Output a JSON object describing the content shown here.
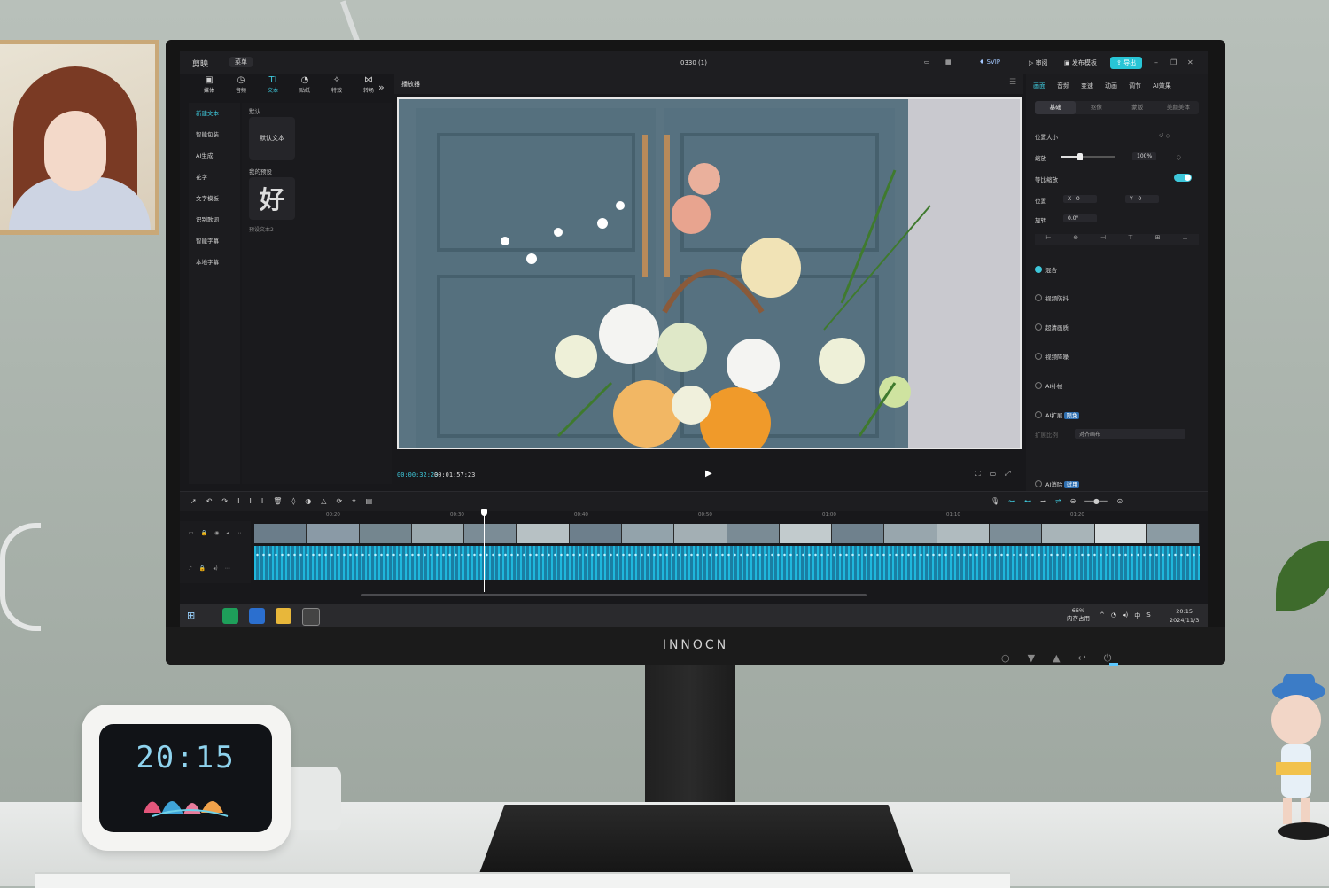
{
  "app": {
    "name": "剪映",
    "menu": "菜单",
    "doc_title": "0330 (1)",
    "svip": "SVIP",
    "buttons": {
      "feedback": "审阅",
      "publish": "发布模板",
      "export": "导出"
    }
  },
  "toolbar": {
    "tools": [
      {
        "label": "媒体",
        "icon": "media-icon"
      },
      {
        "label": "音频",
        "icon": "audio-icon"
      },
      {
        "label": "文本",
        "icon": "text-icon",
        "active": true
      },
      {
        "label": "贴纸",
        "icon": "sticker-icon"
      },
      {
        "label": "特效",
        "icon": "effects-icon"
      },
      {
        "label": "转场",
        "icon": "transition-icon"
      }
    ]
  },
  "text_panel": {
    "nav": [
      "新建文本",
      "智能包装",
      "AI生成",
      "花字",
      "文字模板",
      "识别歌词",
      "智能字幕",
      "本地字幕"
    ],
    "section_default": "默认",
    "default_card": "默认文本",
    "section_my": "我的预设",
    "preset_char": "好",
    "preset_caption": "预设文本2"
  },
  "player": {
    "title": "播放器",
    "time_current": "00:00:32:23",
    "time_total": "00:01:57:23"
  },
  "inspector": {
    "tabs": [
      "画面",
      "音频",
      "变速",
      "动画",
      "调节",
      "AI效果"
    ],
    "subtabs": [
      "基础",
      "抠像",
      "蒙版",
      "美颜美体"
    ],
    "position_size": "位置大小",
    "scale_label": "缩放",
    "scale_value": "100%",
    "uniform_scale": "等比缩放",
    "position_label": "位置",
    "pos_x_label": "X",
    "pos_x": "0",
    "pos_y_label": "Y",
    "pos_y": "0",
    "rotate_label": "旋转",
    "rotate_value": "0.0°",
    "blend": "混合",
    "stabilize": "视频防抖",
    "hd": "超清画质",
    "denoise": "视频降噪",
    "ai_fill": "AI补帧",
    "ai_expand": "AI扩展",
    "ai_expand_badge": "限免",
    "expand_ratio_label": "扩展比例",
    "expand_ratio_value": "对齐画布",
    "ai_remove": "AI消除",
    "ai_remove_badge": "试用"
  },
  "timeline": {
    "ticks": [
      "00:20",
      "00:30",
      "00:40",
      "00:50",
      "01:00",
      "01:10",
      "01:20"
    ]
  },
  "taskbar": {
    "memory_pct": "66%",
    "memory_label": "内存占用",
    "ime": "中",
    "time": "20:15",
    "date": "2024/11/3"
  },
  "monitor": {
    "brand": "INNOCN"
  },
  "clock": {
    "time": "20:15"
  },
  "colors": {
    "accent": "#3ec7da",
    "panel": "#1c1c1f",
    "audio": "#1a7ea3"
  }
}
